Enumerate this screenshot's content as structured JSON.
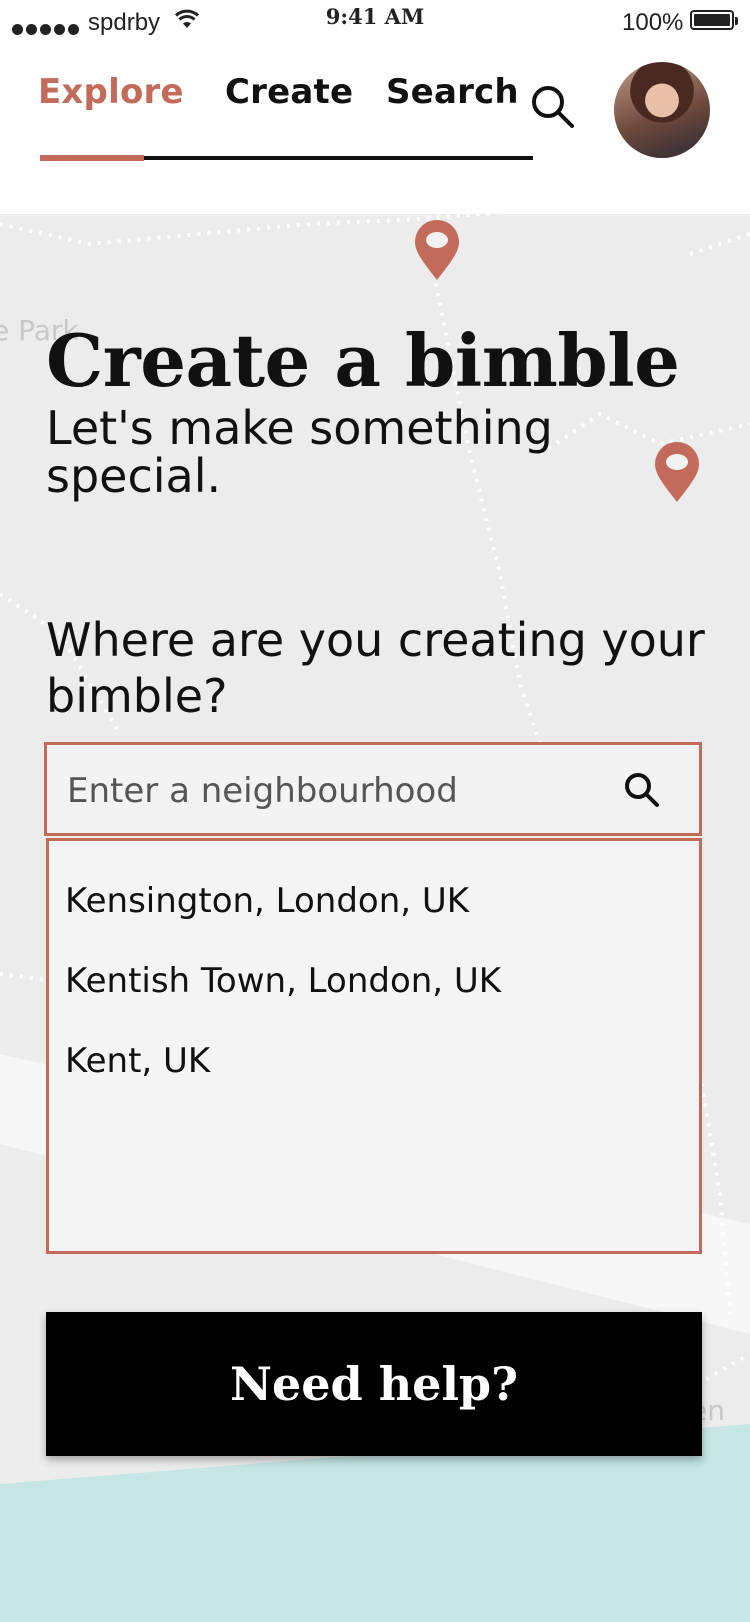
{
  "status_bar": {
    "carrier": "spdrby",
    "time": "9:41 AM",
    "battery": "100%"
  },
  "nav": {
    "tabs": [
      {
        "label": "Explore",
        "active": true
      },
      {
        "label": "Create",
        "active": false
      },
      {
        "label": "Search",
        "active": false
      }
    ]
  },
  "map": {
    "labels": [
      "e Park",
      "en"
    ]
  },
  "page": {
    "title": "Create a bimble",
    "subtitle": "Let's make something special.",
    "question": "Where are you creating your bimble?"
  },
  "search": {
    "placeholder": "Enter a neighbourhood",
    "value": ""
  },
  "suggestions": [
    "Kensington, London, UK",
    "Kentish Town, London, UK",
    "Kent, UK"
  ],
  "help_button": {
    "label": "Need help?"
  },
  "colors": {
    "accent": "#c26b5a",
    "map_bg": "#ececec",
    "water": "#c5e6e5"
  }
}
